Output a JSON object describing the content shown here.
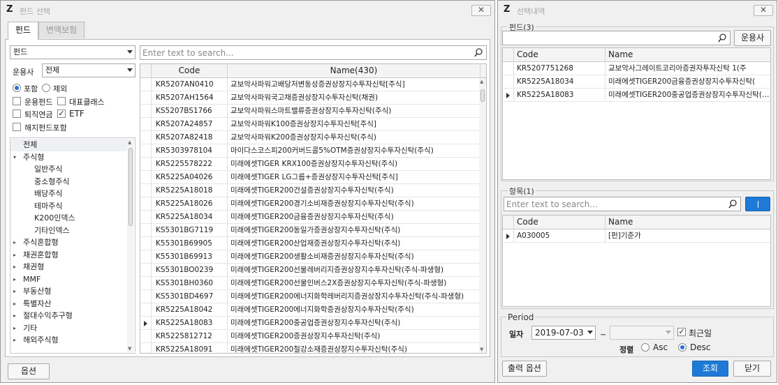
{
  "left_window": {
    "title": "펀드 선택",
    "tabs": [
      {
        "label": "펀드"
      },
      {
        "label": "변액보험"
      }
    ],
    "filter": {
      "type_value": "펀드",
      "manager_label": "운용사",
      "manager_value": "전체",
      "include_label": "포함",
      "exclude_label": "제외",
      "opt_fund_label": "운용펀드",
      "opt_class_label": "대표클래스",
      "opt_pension_label": "퇴직연금",
      "opt_etf_label": "ETF",
      "opt_closed_label": "해지펀드포함"
    },
    "tree": [
      {
        "label": "전체",
        "level": 0,
        "toggle": ""
      },
      {
        "label": "주식형",
        "level": 0,
        "toggle": "▾"
      },
      {
        "label": "일반주식",
        "level": 1,
        "toggle": ""
      },
      {
        "label": "중소형주식",
        "level": 1,
        "toggle": ""
      },
      {
        "label": "배당주식",
        "level": 1,
        "toggle": ""
      },
      {
        "label": "테마주식",
        "level": 1,
        "toggle": ""
      },
      {
        "label": "K200인덱스",
        "level": 1,
        "toggle": ""
      },
      {
        "label": "기타인덱스",
        "level": 1,
        "toggle": ""
      },
      {
        "label": "주식혼합형",
        "level": 0,
        "toggle": "▸"
      },
      {
        "label": "채권혼합형",
        "level": 0,
        "toggle": "▸"
      },
      {
        "label": "채권형",
        "level": 0,
        "toggle": "▸"
      },
      {
        "label": "MMF",
        "level": 0,
        "toggle": "▸"
      },
      {
        "label": "부동산형",
        "level": 0,
        "toggle": "▸"
      },
      {
        "label": "특별자산",
        "level": 0,
        "toggle": "▸"
      },
      {
        "label": "절대수익추구형",
        "level": 0,
        "toggle": "▸"
      },
      {
        "label": "기타",
        "level": 0,
        "toggle": "▸"
      },
      {
        "label": "해외주식형",
        "level": 0,
        "toggle": "▸"
      }
    ],
    "search_placeholder": "Enter text to search...",
    "grid": {
      "headers": {
        "code": "Code",
        "name": "Name(430)"
      },
      "rows": [
        {
          "code": "KR5207AN0410",
          "name": "교보악사파워고배당저변동성증권상장지수투자신탁[주식]"
        },
        {
          "code": "KR5207AH1564",
          "name": "교보악사파워국고채증권상장지수투자신탁(채권)"
        },
        {
          "code": "KS5207BS1766",
          "name": "교보악사파워스마트밸류증권상장지수투자신탁(주식)"
        },
        {
          "code": "KR5207A24857",
          "name": "교보악사파워K100증권상장지수투자신탁[주식]"
        },
        {
          "code": "KR5207A82418",
          "name": "교보악사파워K200증권상장지수투자신탁(주식)"
        },
        {
          "code": "KR5303978104",
          "name": "마이다스코스피200커버드콜5%OTM증권상장지수투자신탁(주식)"
        },
        {
          "code": "KR5225578222",
          "name": "미래에셋TIGER KRX100증권상장지수투자신탁(주식)"
        },
        {
          "code": "KR5225A04026",
          "name": "미래에셋TIGER LG그룹+증권상장지수투자신탁[주식]"
        },
        {
          "code": "KR5225A18018",
          "name": "미래에셋TIGER200건설증권상장지수투자신탁(주식)"
        },
        {
          "code": "KR5225A18026",
          "name": "미래에셋TIGER200경기소비재증권상장지수투자신탁(주식)"
        },
        {
          "code": "KR5225A18034",
          "name": "미래에셋TIGER200금융증권상장지수투자신탁(주식)"
        },
        {
          "code": "KS5301BG7119",
          "name": "미래에셋TIGER200동일가증권상장지수투자신탁(주식)"
        },
        {
          "code": "K55301B69905",
          "name": "미래에셋TIGER200산업재증권상장지수투자신탁(주식)"
        },
        {
          "code": "K55301B69913",
          "name": "미래에셋TIGER200생활소비재증권상장지수투자신탁(주식)"
        },
        {
          "code": "KS5301BO0239",
          "name": "미래에셋TIGER200선물레버리지증권상장지수투자신탁(주식-파생형)"
        },
        {
          "code": "KS5301BH0360",
          "name": "미래에셋TIGER200선물인버스2X증권상장지수투자신탁(주식-파생형)"
        },
        {
          "code": "KS5301BD4697",
          "name": "미래에셋TIGER200에너지화학레버리지증권상장지수투자신탁(주식-파생형)"
        },
        {
          "code": "KR5225A18042",
          "name": "미래에셋TIGER200에너지화학증권상장지수투자신탁(주식)"
        },
        {
          "code": "KR5225A18083",
          "name": "미래에셋TIGER200중공업증권상장지수투자신탁(주식)",
          "marker": true
        },
        {
          "code": "KR5225812712",
          "name": "미래에셋TIGER200증권상장지수투자신탁(주식)"
        },
        {
          "code": "KR5225A18091",
          "name": "미래에셋TIGER200철강소재증권상장지수투자신탁(주식)"
        }
      ]
    },
    "options_button": "옵션"
  },
  "right_window": {
    "title": "선택내역",
    "fund_group_title": "펀드(3)",
    "manager_button": "운용사",
    "fund_grid": {
      "headers": {
        "code": "Code",
        "name": "Name"
      },
      "rows": [
        {
          "code": "KR5207751268",
          "name": "교보악사그레이트코리아증권자투자신탁 1(주"
        },
        {
          "code": "KR5225A18034",
          "name": "미래에셋TIGER200금융증권상장지수투자신탁("
        },
        {
          "code": "KR5225A18083",
          "name": "미래에셋TIGER200중공업증권상장지수투자신탁(주식)",
          "marker": true
        }
      ]
    },
    "item_group_title": "항목(1)",
    "item_search_placeholder": "Enter text to search...",
    "item_grid": {
      "headers": {
        "code": "Code",
        "name": "Name"
      },
      "rows": [
        {
          "code": "A030005",
          "name": "[펀]기준가",
          "marker": true
        }
      ]
    },
    "period": {
      "title": "Period",
      "date_label": "일자",
      "date_value": "2019-07-03",
      "tilde": "~",
      "recent_label": "최근일",
      "sort_label": "정렬",
      "asc_label": "Asc",
      "desc_label": "Desc"
    },
    "print_options_button": "출력 옵션",
    "search_button": "조회",
    "close_button": "닫기"
  }
}
